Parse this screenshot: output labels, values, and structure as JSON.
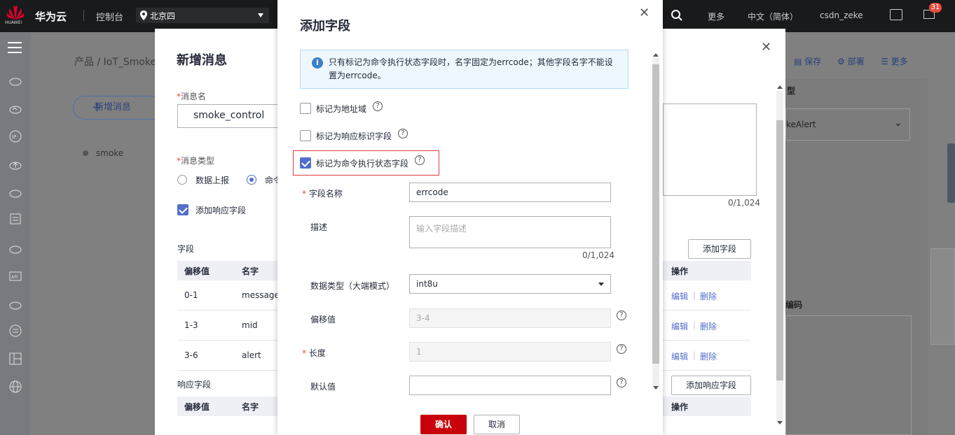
{
  "topbar": {
    "logo_text": "HUAWEI",
    "brand": "华为云",
    "console": "控制台",
    "region": "北京四",
    "more": "更多",
    "lang": "中文（简体）",
    "user": "csdn_zeke",
    "badge": "31"
  },
  "background": {
    "breadcrumb": "产品 / IoT_Smoke",
    "new_message_button": "新增消息",
    "message_list_item": "smoke",
    "actions": {
      "save": "保存",
      "deploy": "部署",
      "more": "更多"
    },
    "peek_select_value": "keAlert",
    "peek_label_type": "型",
    "peek_label_code": "编码",
    "peek_counter": "0/1,024"
  },
  "dialog1": {
    "title": "新增消息",
    "message_name_label": "消息名",
    "message_name_value": "smoke_control",
    "message_type_label": "消息类型",
    "type_options": [
      "数据上报",
      "命令"
    ],
    "add_response_label": "添加响应字段",
    "fields_section": "字段",
    "response_section": "响应字段",
    "columns": {
      "offset": "偏移值",
      "name": "名字",
      "action": "操作"
    },
    "rows": [
      {
        "offset": "0-1",
        "name": "messageI",
        "edit": "编辑",
        "delete": "删除"
      },
      {
        "offset": "1-3",
        "name": "mid",
        "edit": "编辑",
        "delete": "删除"
      },
      {
        "offset": "3-6",
        "name": "alert",
        "edit": "编辑",
        "delete": "删除"
      }
    ],
    "add_field_button": "添加字段",
    "add_response_button": "添加响应字段"
  },
  "dialog2": {
    "title": "添加字段",
    "info_text": "只有标记为命令执行状态字段时，名字固定为errcode；其他字段名字不能设置为errcode。",
    "cb_address": "标记为地址域",
    "cb_response": "标记为响应标识字段",
    "cb_command_status": "标记为命令执行状态字段",
    "field_name_label": "字段名称",
    "field_name_value": "errcode",
    "desc_label": "描述",
    "desc_placeholder": "输入字段描述",
    "desc_counter": "0/1,024",
    "datatype_label": "数据类型（大端模式）",
    "datatype_value": "int8u",
    "offset_label": "偏移值",
    "offset_value": "3-4",
    "length_label": "长度",
    "length_value": "1",
    "default_label": "默认值",
    "default_value": "",
    "confirm": "确认",
    "cancel": "取消"
  },
  "colors": {
    "brand_red": "#c7000b",
    "accent": "#526ecc",
    "highlight": "#e03c3c"
  }
}
